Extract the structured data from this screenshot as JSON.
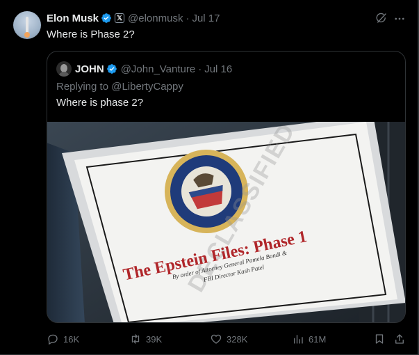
{
  "post": {
    "author_name": "Elon Musk",
    "affiliate_badge": "𝕏",
    "handle": "@elonmusk",
    "separator": "·",
    "date": "Jul 17",
    "text": "Where is Phase 2?"
  },
  "quote": {
    "author_name": "JOHN",
    "handle": "@John_Vanture",
    "separator": "·",
    "date": "Jul 16",
    "replying_to": "Replying to @LibertyCappy",
    "text": "Where is phase 2?",
    "media": {
      "title": "The Epstein Files: Phase 1",
      "subtitle_line1": "By order of Attorney General Pamela Bondi &",
      "subtitle_line2": "FBI Director Kash Patel",
      "stamp": "DECLASSIFIED",
      "seal_text": "DEPARTMENT OF JUSTICE"
    }
  },
  "actions": {
    "replies": "16K",
    "reposts": "39K",
    "likes": "328K",
    "views": "61M"
  },
  "icons": {
    "verified": "verified-badge-icon",
    "grok": "grok-icon",
    "more": "more-icon",
    "reply": "reply-icon",
    "repost": "repost-icon",
    "like": "heart-icon",
    "views": "views-chart-icon",
    "bookmark": "bookmark-icon",
    "share": "share-icon"
  },
  "colors": {
    "background": "#000000",
    "text": "#e7e9ea",
    "muted": "#71767b",
    "border": "#2f3336",
    "verified_blue": "#1d9bf0",
    "title_red": "#b0262a"
  }
}
